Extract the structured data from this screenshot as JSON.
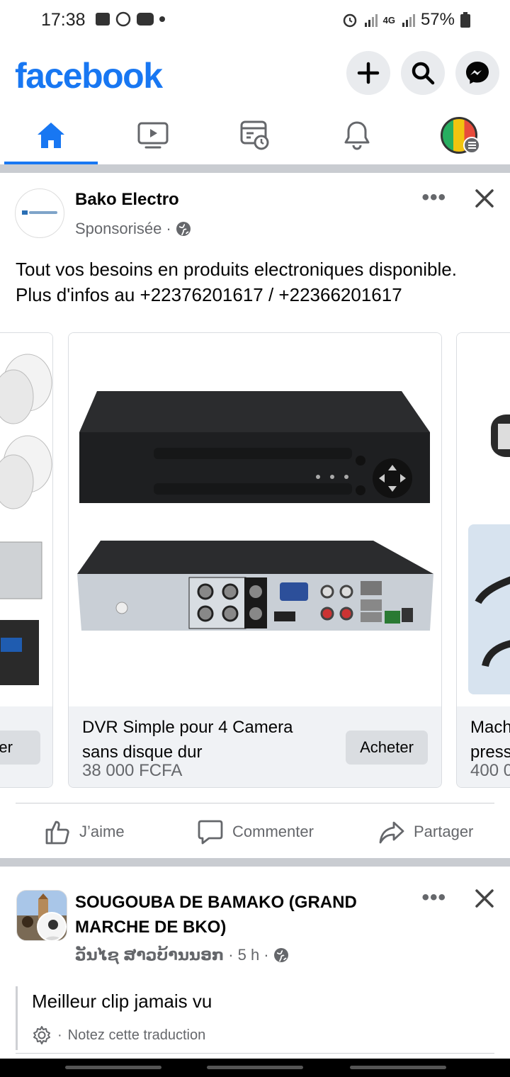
{
  "status_bar": {
    "time": "17:38",
    "network": "4G",
    "battery": "57%"
  },
  "header": {
    "logo": "facebook",
    "buttons": [
      "plus-icon",
      "search-icon",
      "messenger-icon"
    ]
  },
  "tabs": [
    "home",
    "watch",
    "memories",
    "notifications",
    "menu"
  ],
  "post1": {
    "page_name": "Bako Electro",
    "sponsored": "Sponsorisée",
    "text_line1": "Tout vos besoins en produits electroniques disponible.",
    "text_line2": "Plus d'infos au +22376201617 / +22366201617",
    "cards": [
      {
        "title_partial": "",
        "button": "eter"
      },
      {
        "title": "DVR Simple pour 4 Camera sans disque dur",
        "price": "38 000 FCFA",
        "button": "Acheter"
      },
      {
        "title_line1": "Mach",
        "title_line2": "press",
        "price": "400 0"
      }
    ],
    "actions": {
      "like": "J’aime",
      "comment": "Commenter",
      "share": "Partager"
    }
  },
  "post2": {
    "page_name_line1": "SOUGOUBA DE BAMAKO (GRAND",
    "page_name_line2": "MARCHE DE BKO)",
    "author": "ວັນໄຊ ສາວບ້ານນອກ",
    "time": "5 h",
    "text": "Meilleur clip jamais vu",
    "translate_note": "Notez cette traduction"
  },
  "colors": {
    "brand": "#1877f2",
    "secondary_text": "#65676b",
    "separator": "#c9ccd1"
  }
}
